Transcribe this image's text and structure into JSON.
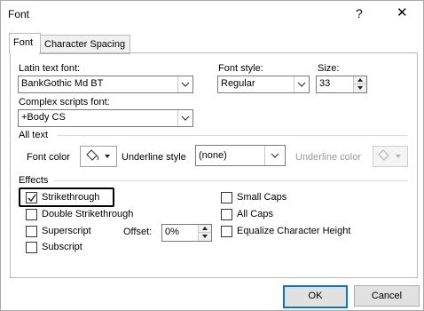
{
  "window": {
    "title": "Font",
    "help_glyph": "?",
    "close_glyph": "✕"
  },
  "tabs": [
    {
      "label": "Font",
      "active": true
    },
    {
      "label": "Character Spacing",
      "active": false
    }
  ],
  "latin_font": {
    "label": "Latin text font:",
    "value": "BankGothic Md BT"
  },
  "font_style": {
    "label": "Font style:",
    "value": "Regular"
  },
  "size": {
    "label": "Size:",
    "value": "33"
  },
  "complex_font": {
    "label": "Complex scripts font:",
    "value": "+Body CS"
  },
  "all_text": {
    "section_label": "All text",
    "font_color_label": "Font color",
    "underline_style_label": "Underline style",
    "underline_style_value": "(none)",
    "underline_color_label": "Underline color"
  },
  "effects": {
    "section_label": "Effects",
    "strikethrough": {
      "label": "Strikethrough",
      "checked": true
    },
    "double_strikethrough": {
      "label": "Double Strikethrough",
      "checked": false
    },
    "superscript": {
      "label": "Superscript",
      "checked": false
    },
    "subscript": {
      "label": "Subscript",
      "checked": false
    },
    "offset_label": "Offset:",
    "offset_value": "0%",
    "small_caps": {
      "label": "Small Caps",
      "checked": false
    },
    "all_caps": {
      "label": "All Caps",
      "checked": false
    },
    "equalize_height": {
      "label": "Equalize Character Height",
      "checked": false
    }
  },
  "buttons": {
    "ok": "OK",
    "cancel": "Cancel"
  },
  "colors": {
    "accent": "#0078d7",
    "border": "#7a7a7a",
    "disabled_text": "#9a9a9a"
  }
}
